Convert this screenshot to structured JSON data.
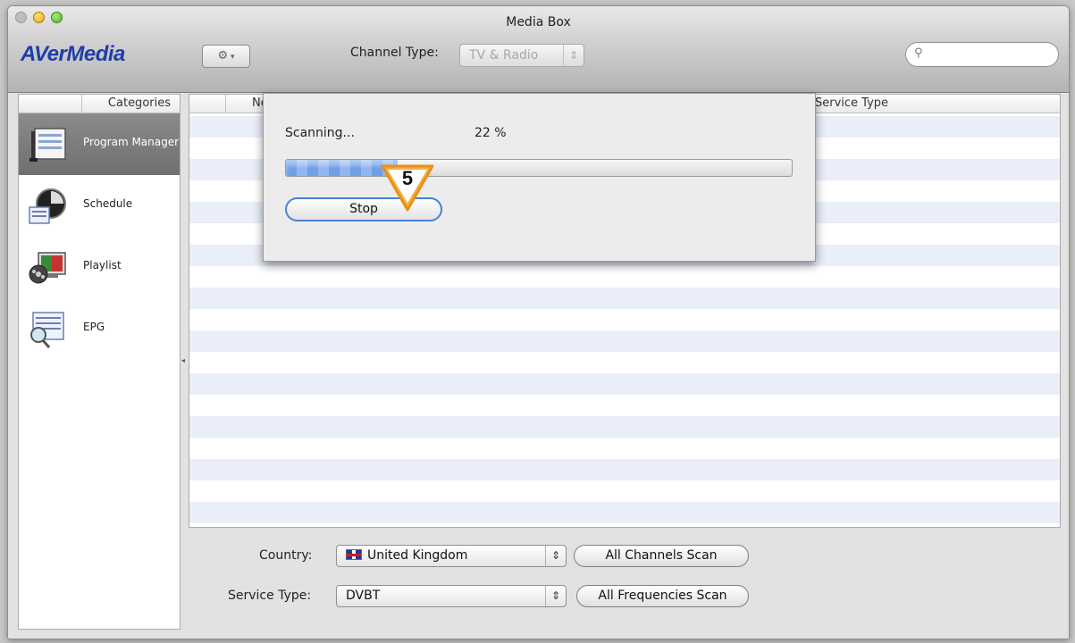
{
  "window": {
    "title": "Media Box"
  },
  "toolbar": {
    "logo": "AVerMedia",
    "gear_icon": "gear-icon",
    "channel_type_label": "Channel Type:",
    "channel_type_value": "TV & Radio",
    "search_placeholder": ""
  },
  "sidebar": {
    "header": "Categories",
    "items": [
      {
        "label": "Program Manager",
        "icon": "program-manager-icon",
        "selected": true
      },
      {
        "label": "Schedule",
        "icon": "schedule-icon",
        "selected": false
      },
      {
        "label": "Playlist",
        "icon": "playlist-icon",
        "selected": false
      },
      {
        "label": "EPG",
        "icon": "epg-icon",
        "selected": false
      }
    ]
  },
  "table": {
    "columns": [
      "Ne",
      "Service Type"
    ]
  },
  "scan_sheet": {
    "status": "Scanning...",
    "percent_text": "22 %",
    "progress": 0.22,
    "stop_label": "Stop",
    "marker_number": "5"
  },
  "bottom": {
    "country_label": "Country:",
    "country_value": "United Kingdom",
    "service_type_label": "Service Type:",
    "service_type_value": "DVBT",
    "all_channels_label": "All Channels Scan",
    "all_frequencies_label": "All Frequencies Scan"
  },
  "colors": {
    "logo": "#1d3fa8",
    "progress": "#6f9fe6",
    "selection": "#7a7a7a"
  }
}
